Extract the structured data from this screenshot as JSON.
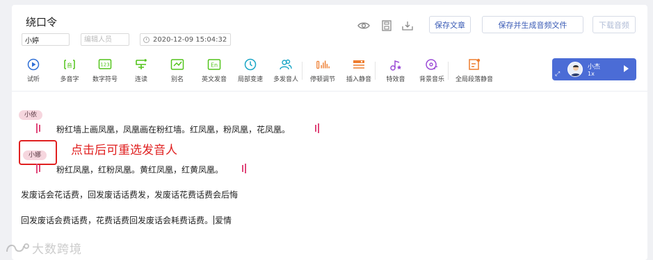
{
  "document": {
    "title": "绕口令",
    "author": "小婷",
    "editor_placeholder": "编辑人员",
    "datetime": "2020-12-09 15:04:32"
  },
  "header_actions": {
    "save_article": "保存文章",
    "save_and_generate": "保存并生成音频文件",
    "download_audio": "下载音频"
  },
  "toolbar": {
    "items": [
      {
        "label": "试听",
        "icon": "play-circle-icon"
      },
      {
        "label": "多音字",
        "icon": "polyphone-icon"
      },
      {
        "label": "数字符号",
        "icon": "number-symbol-icon"
      },
      {
        "label": "连读",
        "icon": "liaison-icon"
      },
      {
        "label": "别名",
        "icon": "alias-icon"
      },
      {
        "label": "英文发音",
        "icon": "english-pronunciation-icon"
      },
      {
        "label": "局部变速",
        "icon": "local-speed-icon"
      },
      {
        "label": "多发音人",
        "icon": "multi-speaker-icon"
      },
      {
        "label": "停顿调节",
        "icon": "pause-adjust-icon"
      },
      {
        "label": "插入静音",
        "icon": "insert-silence-icon"
      },
      {
        "label": "特效音",
        "icon": "sound-effect-icon"
      },
      {
        "label": "背景音乐",
        "icon": "background-music-icon"
      },
      {
        "label": "全局段落静音",
        "icon": "global-paragraph-silence-icon"
      }
    ]
  },
  "voice": {
    "name": "小杰",
    "speed": "1x"
  },
  "content": {
    "segments": [
      {
        "speaker": "小依",
        "text": "粉红墙上画凤凰，凤凰画在粉红墙。红凤凰，粉凤凰，花凤凰。"
      },
      {
        "speaker": "小娜",
        "text": "粉红凤凰，红粉凤凰。黄红凤凰，红黄凤凰。"
      }
    ],
    "annotation": "点击后可重选发音人",
    "paragraph1": "发废话会花话费，回发废话话费发，发废话花费话费会后悔",
    "paragraph2_before": "回发废话会费话费，花费话费回发废话会耗费话费。",
    "paragraph2_after": "爱情"
  },
  "watermark": "大数跨境",
  "colors": {
    "accent": "#4b6cd6",
    "speaker_tag_bg": "#f6d6de",
    "pause_mark": "#e0477a",
    "annotation_red": "#e02020",
    "toolbar_green": "#52c41a"
  }
}
